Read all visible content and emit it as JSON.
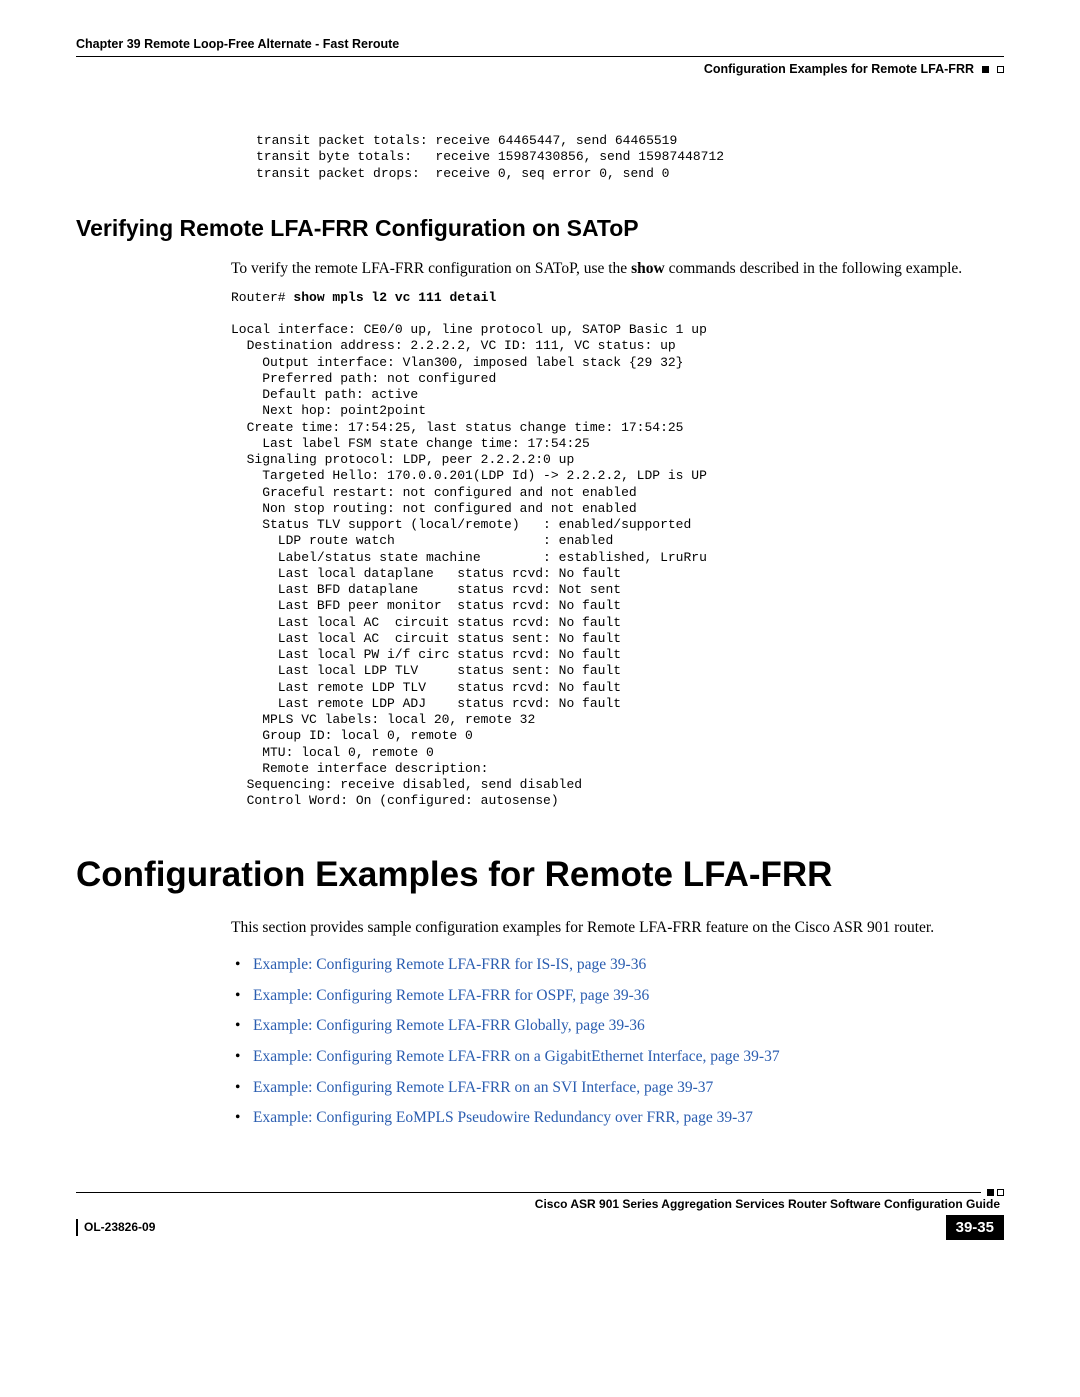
{
  "header": {
    "chapter": "Chapter 39      Remote Loop-Free Alternate - Fast Reroute",
    "section": "Configuration Examples for Remote LFA-FRR"
  },
  "code1": "transit packet totals: receive 64465447, send 64465519\ntransit byte totals:   receive 15987430856, send 15987448712\ntransit packet drops:  receive 0, seq error 0, send 0",
  "heading2": "Verifying Remote LFA-FRR Configuration on SAToP",
  "para1a": "To verify the remote LFA-FRR configuration on SAToP, use the ",
  "para1b": "show",
  "para1c": " commands described in the following example.",
  "code2_prompt": "Router# ",
  "code2_cmd": "show mpls l2 vc 111 detail",
  "code2_body": "\nLocal interface: CE0/0 up, line protocol up, SATOP Basic 1 up\n  Destination address: 2.2.2.2, VC ID: 111, VC status: up\n    Output interface: Vlan300, imposed label stack {29 32}\n    Preferred path: not configured\n    Default path: active\n    Next hop: point2point\n  Create time: 17:54:25, last status change time: 17:54:25\n    Last label FSM state change time: 17:54:25\n  Signaling protocol: LDP, peer 2.2.2.2:0 up\n    Targeted Hello: 170.0.0.201(LDP Id) -> 2.2.2.2, LDP is UP\n    Graceful restart: not configured and not enabled\n    Non stop routing: not configured and not enabled\n    Status TLV support (local/remote)   : enabled/supported\n      LDP route watch                   : enabled\n      Label/status state machine        : established, LruRru\n      Last local dataplane   status rcvd: No fault\n      Last BFD dataplane     status rcvd: Not sent\n      Last BFD peer monitor  status rcvd: No fault\n      Last local AC  circuit status rcvd: No fault\n      Last local AC  circuit status sent: No fault\n      Last local PW i/f circ status rcvd: No fault\n      Last local LDP TLV     status sent: No fault\n      Last remote LDP TLV    status rcvd: No fault\n      Last remote LDP ADJ    status rcvd: No fault\n    MPLS VC labels: local 20, remote 32\n    Group ID: local 0, remote 0\n    MTU: local 0, remote 0\n    Remote interface description:\n  Sequencing: receive disabled, send disabled\n  Control Word: On (configured: autosense)",
  "heading1": "Configuration Examples for Remote LFA-FRR",
  "para2": "This section provides sample configuration examples for Remote LFA-FRR feature on the Cisco ASR 901 router.",
  "links": [
    "Example: Configuring Remote LFA-FRR for IS-IS, page 39-36",
    "Example: Configuring Remote LFA-FRR for OSPF, page 39-36",
    "Example: Configuring Remote LFA-FRR Globally, page 39-36",
    "Example: Configuring Remote LFA-FRR on a GigabitEthernet Interface, page 39-37",
    "Example: Configuring Remote LFA-FRR on an SVI Interface, page 39-37",
    "Example: Configuring EoMPLS Pseudowire Redundancy over FRR, page 39-37"
  ],
  "footer": {
    "guide": "Cisco ASR 901 Series Aggregation Services Router Software Configuration Guide",
    "docid": "OL-23826-09",
    "pagenum": "39-35"
  }
}
